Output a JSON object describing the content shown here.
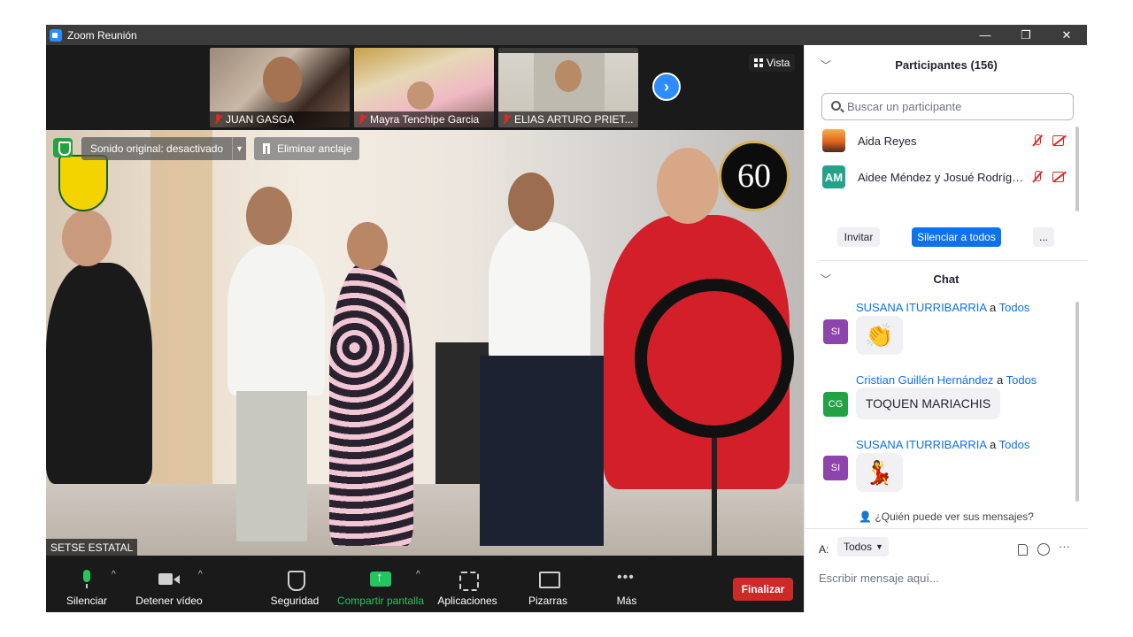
{
  "window": {
    "title": "Zoom Reunión",
    "controls": [
      "—",
      "❐",
      "✕"
    ]
  },
  "video": {
    "thumbnails": [
      {
        "name": "JUAN GASGA"
      },
      {
        "name": "Mayra Tenchipe Garcia"
      },
      {
        "name": "ELIAS ARTURO PRIET..."
      }
    ],
    "view_label": "Vista",
    "original_sound": "Sonido original: desactivado",
    "unpin_label": "Eliminar anclaje",
    "speaker_name": "SETSE ESTATAL",
    "badge_60": "60"
  },
  "toolbar": {
    "mute_label": "Silenciar",
    "video_label": "Detener vídeo",
    "security_label": "Seguridad",
    "share_label": "Compartir pantalla",
    "apps_label": "Aplicaciones",
    "whiteboard_label": "Pizarras",
    "more_label": "Más",
    "end_label": "Finalizar",
    "colors": {
      "share_green": "#22c55e",
      "end_red": "#cc2929"
    }
  },
  "participants": {
    "header": "Participantes (156)",
    "search_placeholder": "Buscar un participante",
    "list": [
      {
        "name": "Aida Reyes",
        "avatar": ""
      },
      {
        "name": "Aidee Méndez y Josué Rodrígu...",
        "avatar": "AM"
      }
    ],
    "invite_label": "Invitar",
    "mute_all_label": "Silenciar a todos",
    "more_label": "..."
  },
  "chat": {
    "header": "Chat",
    "messages": [
      {
        "sender": "SUSANA ITURRIBARRIA",
        "to_word": "a",
        "recipient": "Todos",
        "avatar": "SI",
        "text": "👏"
      },
      {
        "sender": "Cristian Guillén Hernández",
        "to_word": "a",
        "recipient": "Todos",
        "avatar": "CG",
        "text": "TOQUEN MARIACHIS"
      },
      {
        "sender": "SUSANA ITURRIBARRIA",
        "to_word": "a",
        "recipient": "Todos",
        "avatar": "SI",
        "text": "💃"
      }
    ],
    "who_sees": "¿Quién puede ver sus mensajes?",
    "to_label": "A:",
    "to_value": "Todos",
    "input_placeholder": "Escribir mensaje aquí...",
    "more_label": "···"
  }
}
